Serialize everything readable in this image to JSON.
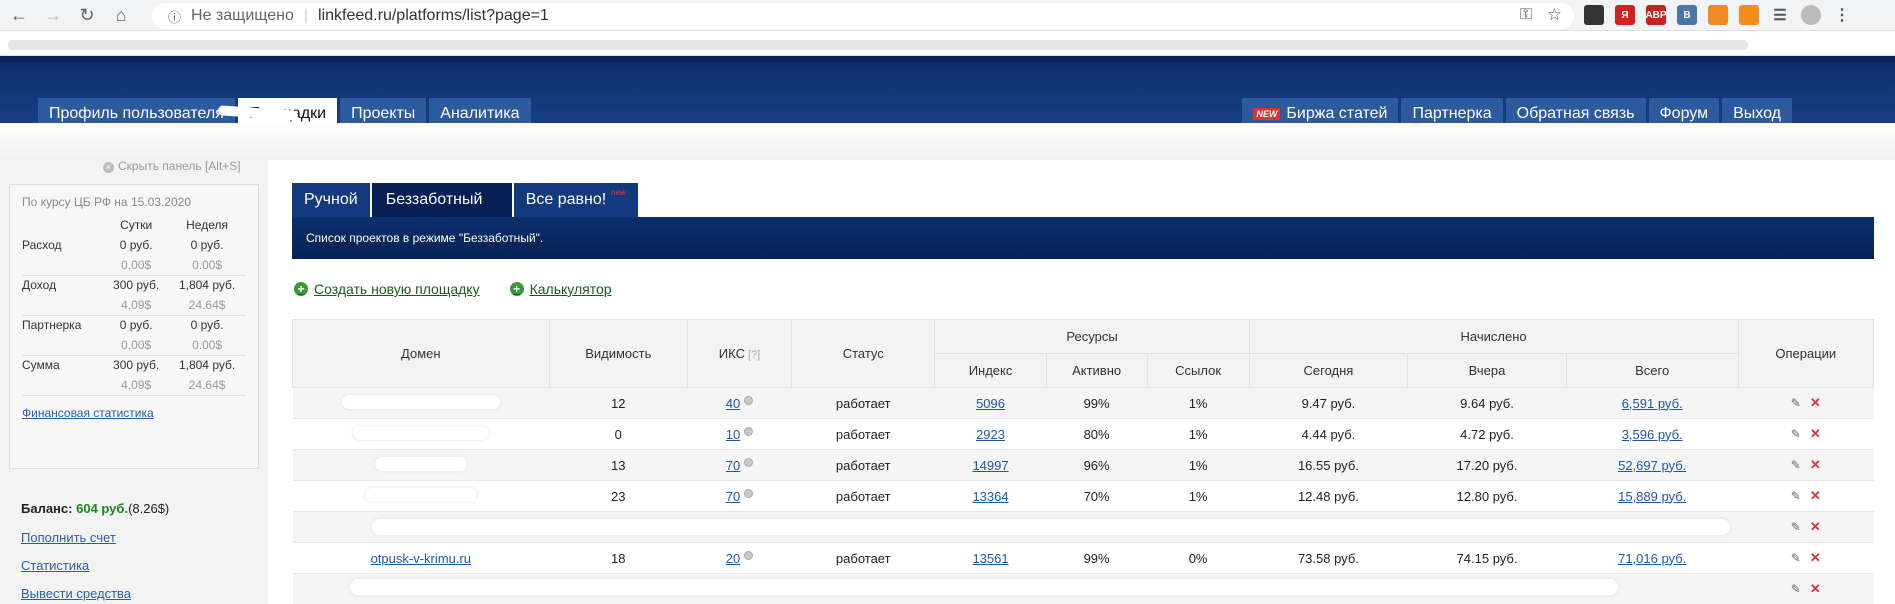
{
  "browser": {
    "url_security": "Не защищено",
    "url": "linkfeed.ru/platforms/list?page=1",
    "extensions": [
      {
        "name": "ext-1",
        "color": "#333333",
        "label": ""
      },
      {
        "name": "ext-2",
        "color": "#d62020",
        "label": "Я"
      },
      {
        "name": "ext-abp",
        "color": "#c72020",
        "label": "ABP"
      },
      {
        "name": "ext-vk",
        "color": "#4a76a8",
        "label": "В"
      },
      {
        "name": "ext-rss",
        "color": "#f08a24",
        "label": ""
      },
      {
        "name": "ext-ok",
        "color": "#f28c1a",
        "label": ""
      }
    ]
  },
  "topnav": {
    "left": [
      {
        "label": "Профиль пользователя",
        "active": false
      },
      {
        "label": "Площадки",
        "active": true
      },
      {
        "label": "Проекты",
        "active": false
      },
      {
        "label": "Аналитика",
        "active": false
      }
    ],
    "right": [
      {
        "label": "Биржа статей",
        "badge": "NEW"
      },
      {
        "label": "Партнерка"
      },
      {
        "label": "Обратная связь"
      },
      {
        "label": "Форум"
      },
      {
        "label": "Выход"
      }
    ]
  },
  "sidebar": {
    "hide_label": "Скрыть панель [Alt+S]",
    "rate_note": "По курсу ЦБ РФ на 15.03.2020",
    "cols": [
      "Сутки",
      "Неделя"
    ],
    "rows": [
      {
        "label": "Расход",
        "day": "0 руб.",
        "week": "0 руб.",
        "day_usd": "0.00$",
        "week_usd": "0.00$"
      },
      {
        "label": "Доход",
        "day": "300 руб.",
        "week": "1,804 руб.",
        "day_usd": "4.09$",
        "week_usd": "24.64$"
      },
      {
        "label": "Партнерка",
        "day": "0 руб.",
        "week": "0 руб.",
        "day_usd": "0.00$",
        "week_usd": "0.00$"
      },
      {
        "label": "Сумма",
        "day": "300 руб.",
        "week": "1,804 руб.",
        "day_usd": "4.09$",
        "week_usd": "24.64$"
      }
    ],
    "fin_link": "Финансовая статистика",
    "balance_label": "Баланс:",
    "balance_amount": "604 руб.",
    "balance_usd": "(8.26$)",
    "links": [
      "Пополнить счет",
      "Статистика",
      "Вывести средства"
    ]
  },
  "subtabs": [
    {
      "label": "Ручной",
      "active": false,
      "sup": ""
    },
    {
      "label": "Беззаботный",
      "active": true,
      "sup": ""
    },
    {
      "label": "Все равно!",
      "active": false,
      "sup": "new"
    }
  ],
  "banner": "Список проектов в режиме \"Беззаботный\".",
  "actions": {
    "create": "Создать новую площадку",
    "calc": "Калькулятор"
  },
  "table": {
    "headers": {
      "domain": "Домен",
      "visibility": "Видимость",
      "iks": "ИКС",
      "iks_q": "[?]",
      "status": "Статус",
      "resources": "Ресурсы",
      "index": "Индекс",
      "active": "Активно",
      "links": "Ссылок",
      "accrued": "Начислено",
      "today": "Сегодня",
      "yesterday": "Вчера",
      "total": "Всего",
      "ops": "Операции"
    },
    "rows": [
      {
        "domain": "",
        "visibility": "12",
        "iks": "40",
        "status": "работает",
        "index": "5096",
        "active": "99%",
        "links": "1%",
        "today": "9.47 руб.",
        "yesterday": "9.64 руб.",
        "total": "6,591 руб.",
        "blur_w": 158
      },
      {
        "domain": "",
        "visibility": "0",
        "iks": "10",
        "status": "работает",
        "index": "2923",
        "active": "80%",
        "links": "1%",
        "today": "4.44 руб.",
        "yesterday": "4.72 руб.",
        "total": "3,596 руб.",
        "blur_w": 136
      },
      {
        "domain": "",
        "visibility": "13",
        "iks": "70",
        "status": "работает",
        "index": "14997",
        "active": "96%",
        "links": "1%",
        "today": "16.55 руб.",
        "yesterday": "17.20 руб.",
        "total": "52,697 руб.",
        "blur_w": 92
      },
      {
        "domain": "",
        "visibility": "23",
        "iks": "70",
        "status": "работает",
        "index": "13364",
        "active": "70%",
        "links": "1%",
        "today": "12.48 руб.",
        "yesterday": "12.80 руб.",
        "total": "15,889 руб.",
        "blur_w": 112
      },
      {
        "domain": "",
        "visibility": "",
        "iks": "",
        "status": "",
        "index": "",
        "active": "",
        "links": "",
        "today": "",
        "yesterday": "",
        "total": "",
        "blur_w": 0
      },
      {
        "domain": "otpusk-v-krimu.ru",
        "visibility": "18",
        "iks": "20",
        "status": "работает",
        "index": "13561",
        "active": "99%",
        "links": "0%",
        "today": "73.58 руб.",
        "yesterday": "74.15 руб.",
        "total": "71,016 руб.",
        "blur_w": 0
      },
      {
        "domain": "",
        "visibility": "",
        "iks": "",
        "status": "",
        "index": "",
        "active": "",
        "links": "",
        "today": "",
        "yesterday": "",
        "total": "",
        "blur_w": 0
      }
    ]
  }
}
